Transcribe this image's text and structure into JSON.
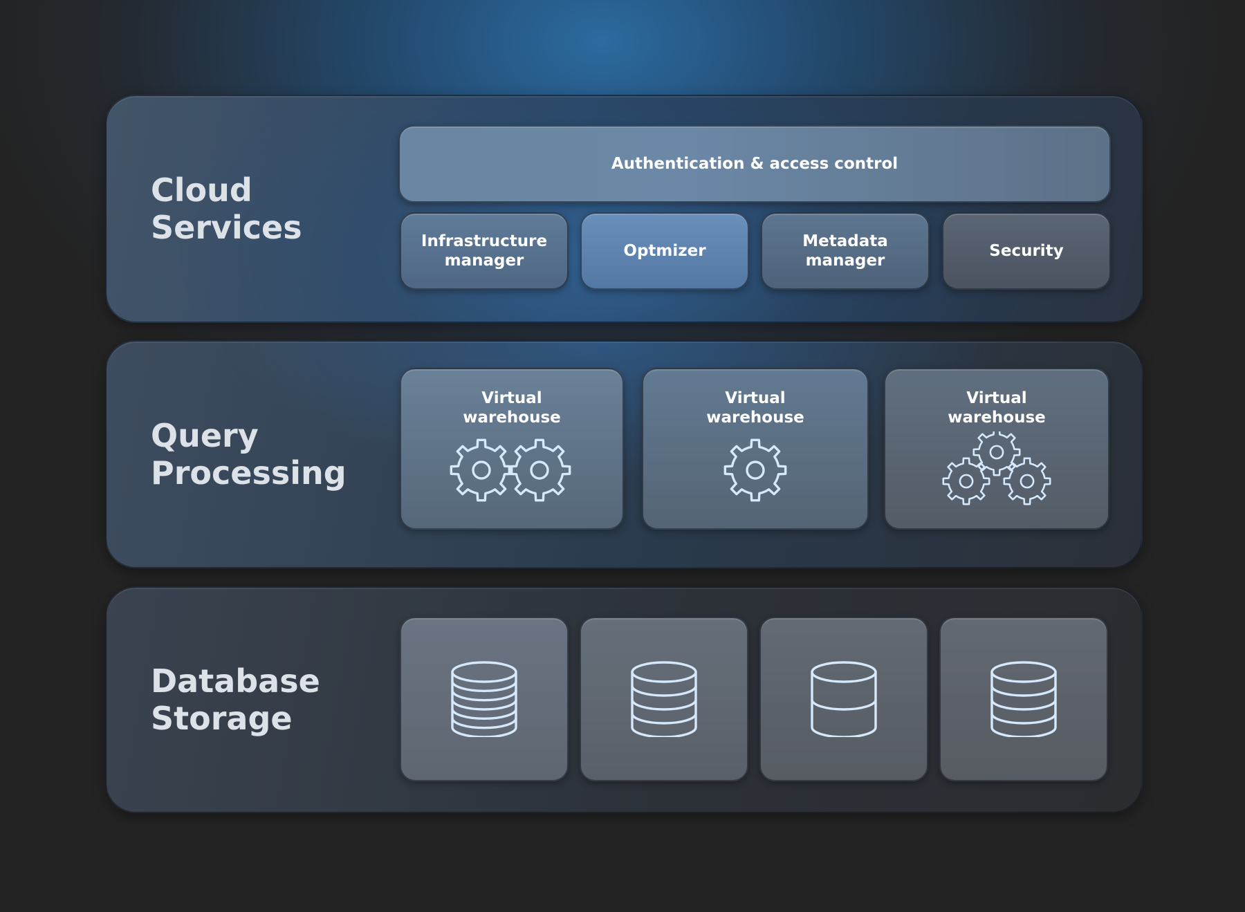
{
  "layers": {
    "cloud": {
      "title": "Cloud\nServices",
      "auth_label": "Authentication & access control",
      "components": [
        "Infrastructure\nmanager",
        "Optmizer",
        "Metadata\nmanager",
        "Security"
      ]
    },
    "query": {
      "title": "Query\nProcessing",
      "warehouses": [
        {
          "label": "Virtual\nwarehouse",
          "icon": "two-gears-icon"
        },
        {
          "label": "Virtual\nwarehouse",
          "icon": "gear-icon"
        },
        {
          "label": "Virtual\nwarehouse",
          "icon": "three-gears-icon"
        }
      ]
    },
    "storage": {
      "title": "Database\nStorage",
      "databases": [
        {
          "icon": "database-icon",
          "disk_count": 6
        },
        {
          "icon": "database-icon",
          "disk_count": 4
        },
        {
          "icon": "database-icon",
          "disk_count": 2
        },
        {
          "icon": "database-icon",
          "disk_count": 4
        }
      ]
    }
  },
  "colors": {
    "icon_stroke": "#d6e8fb",
    "title_text": "#dde2e8",
    "accent_blue": "#2c6aa0"
  }
}
